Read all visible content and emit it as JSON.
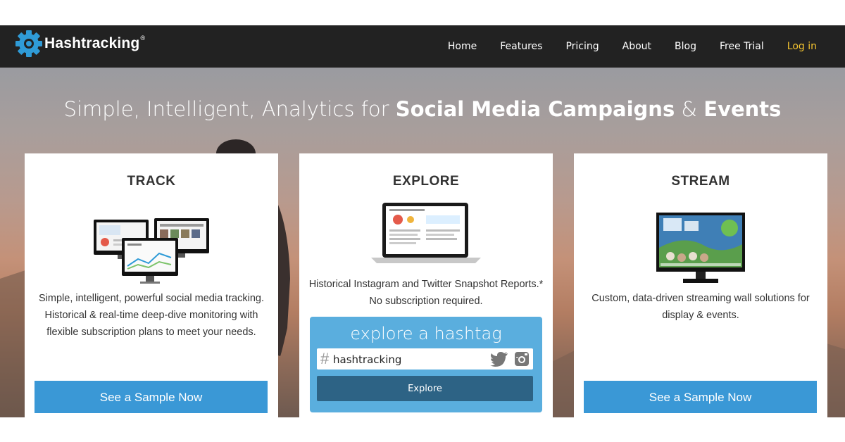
{
  "brand": {
    "name": "Hashtracking",
    "reg_mark": "®",
    "accent": "#2f9bd7"
  },
  "nav": {
    "items": [
      {
        "label": "Home"
      },
      {
        "label": "Features"
      },
      {
        "label": "Pricing"
      },
      {
        "label": "About"
      },
      {
        "label": "Blog"
      },
      {
        "label": "Free Trial"
      },
      {
        "label": "Log in",
        "color": "#f4c430"
      }
    ]
  },
  "hero": {
    "title_light": "Simple, Intelligent, Analytics for ",
    "title_bold_1": "Social Media Campaigns",
    "title_amp": " & ",
    "title_bold_2": "Events"
  },
  "cards": {
    "track": {
      "title": "TRACK",
      "image_icon": "monitors-dashboard-illustration",
      "description": "Simple, intelligent, powerful social media tracking. Historical & real-time deep-dive monitoring with flexible subscription plans to meet your needs.",
      "button": "See a Sample Now"
    },
    "explore": {
      "title": "EXPLORE",
      "image_icon": "laptop-report-illustration",
      "description": "Historical Instagram and Twitter Snapshot Reports.* No subscription required.",
      "box_heading": "explore a hashtag",
      "hash_symbol": "#",
      "input_value": "hashtracking",
      "button": "Explore",
      "icons": [
        "twitter-icon",
        "instagram-icon"
      ]
    },
    "stream": {
      "title": "STREAM",
      "image_icon": "streaming-wall-tv-illustration",
      "description": "Custom, data-driven streaming wall solutions for display & events.",
      "button": "See a Sample Now"
    }
  },
  "colors": {
    "navbar": "#222222",
    "button_blue": "#3a98d6",
    "explore_box": "#5aaede",
    "explore_button": "#2d6385",
    "login": "#f4c430"
  }
}
